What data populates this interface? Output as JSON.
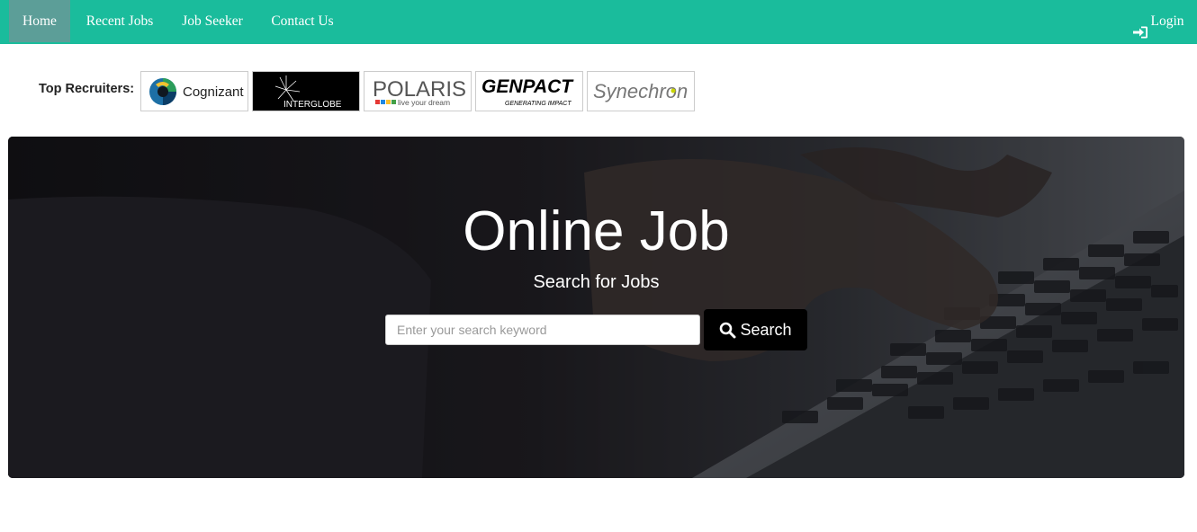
{
  "nav": {
    "items": [
      {
        "label": "Home",
        "active": true
      },
      {
        "label": "Recent Jobs"
      },
      {
        "label": "Job Seeker"
      },
      {
        "label": "Contact Us"
      }
    ],
    "login_label": "Login",
    "login_icon": "sign-in-icon",
    "bg_color": "#1abc9c",
    "active_bg_color": "#5c9e98"
  },
  "recruiters": {
    "label": "Top Recruiters:",
    "logos": [
      {
        "name": "Cognizant",
        "text": "Cognizant"
      },
      {
        "name": "InterGlobe",
        "text": "INTERGLOBE"
      },
      {
        "name": "Polaris",
        "text": "POLARIS",
        "tagline": "live your dream"
      },
      {
        "name": "Genpact",
        "text": "GENPACT",
        "tagline": "GENERATING IMPACT"
      },
      {
        "name": "Synechron",
        "text": "Synechron"
      }
    ]
  },
  "hero": {
    "title": "Online Job",
    "subtitle": "Search for Jobs",
    "search_placeholder": "Enter your search keyword",
    "search_value": "",
    "search_button_label": "Search",
    "search_icon": "search-icon"
  }
}
